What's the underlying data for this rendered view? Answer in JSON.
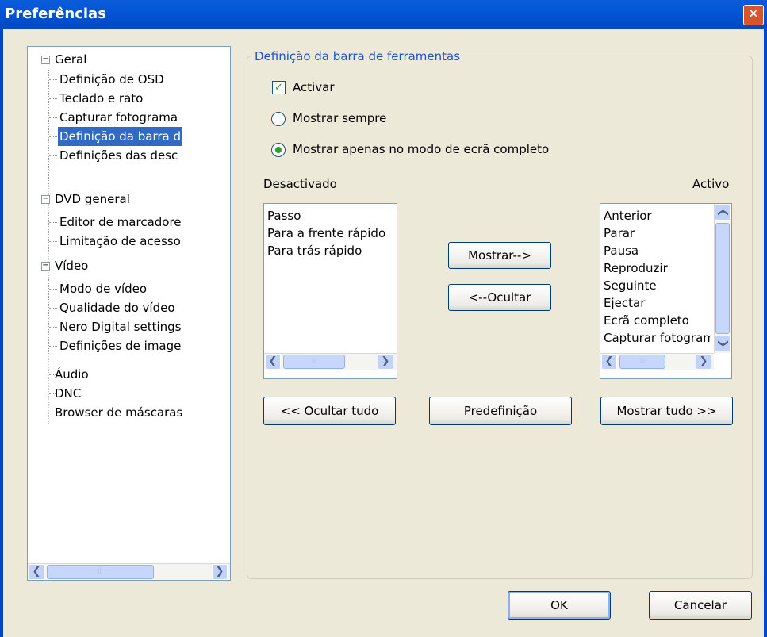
{
  "window": {
    "title": "Preferências",
    "close_glyph": "✕"
  },
  "tree": {
    "items": [
      {
        "label": "Geral",
        "expander": "−"
      },
      {
        "label": "Definição de OSD"
      },
      {
        "label": "Teclado e rato"
      },
      {
        "label": "Capturar fotograma"
      },
      {
        "label": "Definição da barra d"
      },
      {
        "label": "Definições das desc"
      },
      {
        "label": "DVD general",
        "expander": "−"
      },
      {
        "label": "Editor de marcadore"
      },
      {
        "label": "Limitação de acesso"
      },
      {
        "label": "Vídeo",
        "expander": "−"
      },
      {
        "label": "Modo de vídeo"
      },
      {
        "label": "Qualidade do vídeo"
      },
      {
        "label": "Nero Digital settings"
      },
      {
        "label": "Definições de image"
      },
      {
        "label": "Áudio"
      },
      {
        "label": "DNC"
      },
      {
        "label": "Browser de máscaras"
      }
    ],
    "selected_index": 4
  },
  "toolbar_settings": {
    "group_title": "Definição da barra de ferramentas",
    "activate": {
      "label": "Activar",
      "checked": true
    },
    "radio_always": {
      "label": "Mostrar sempre",
      "selected": false
    },
    "radio_fullscreen": {
      "label": "Mostrar apenas no modo de ecrã completo",
      "selected": true
    }
  },
  "lists": {
    "disabled_header": "Desactivado",
    "enabled_header": "Activo",
    "disabled_items": [
      "Passo",
      "Para a frente rápido",
      "Para trás rápido"
    ],
    "enabled_items": [
      "Anterior",
      "Parar",
      "Pausa",
      "Reproduzir",
      "Seguinte",
      "Ejectar",
      "Ecrã completo",
      "Capturar fotograma"
    ]
  },
  "buttons": {
    "show": "Mostrar-->",
    "hide": "<--Ocultar",
    "hide_all": "<< Ocultar tudo",
    "default": "Predefinição",
    "show_all": "Mostrar tudo >>",
    "ok": "OK",
    "cancel": "Cancelar"
  },
  "scroll_glyphs": {
    "left": "❮",
    "right": "❯",
    "up": "❮",
    "down": "❯",
    "grip": "⦙⦙⦙"
  },
  "colors": {
    "titlebar": "#0356d6",
    "selection": "#316ac5",
    "group_title": "#1f54c8",
    "check": "#21a121"
  }
}
